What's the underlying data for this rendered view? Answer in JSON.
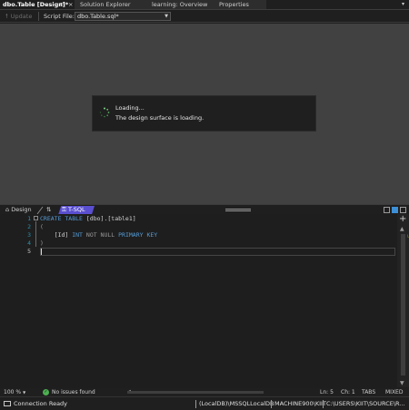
{
  "tabs": [
    {
      "label": "dbo.Table [Design]*",
      "active": true
    },
    {
      "label": "Solution Explorer",
      "active": false
    },
    {
      "label": "learning: Overview",
      "active": false
    },
    {
      "label": "Properties",
      "active": false
    }
  ],
  "tab_controls": {
    "pin": "⊓",
    "close": "×",
    "dropdown": "▾"
  },
  "toolbar": {
    "update_label": "Update",
    "script_file_label": "Script File:",
    "script_file_value": "dbo.Table.sql*"
  },
  "loading": {
    "title": "Loading...",
    "message": "The design surface is loading."
  },
  "pane_bar": {
    "design_label": "Design",
    "swap_icon": "⇅",
    "tsql_label": "T-SQL"
  },
  "editor": {
    "line_numbers": [
      "1",
      "2",
      "3",
      "4",
      "5"
    ],
    "current_line": 5
  },
  "editor_status": {
    "zoom": "100 %",
    "issues": "No issues found",
    "line": "Ln: 5",
    "col": "Ch: 1",
    "tabs": "TABS",
    "mode": "MIXED"
  },
  "statusbar": {
    "connection": "Connection Ready",
    "database": "(LocalDB)\\MSSQLLocalDB",
    "user": "MACHINE900\\KIIT",
    "path": "C:\\USERS\\KIIT\\SOURCE\\R..."
  },
  "colors": {
    "keyword": "#569cd6",
    "tsql_tab": "#5a4fd0",
    "line_number": "#2b91af",
    "ok_badge": "#4caf50"
  }
}
